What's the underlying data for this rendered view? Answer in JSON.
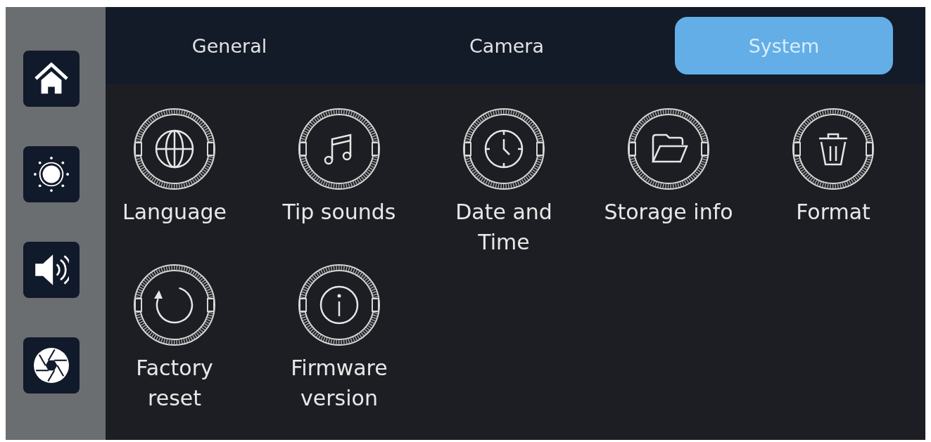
{
  "tabs": [
    {
      "label": "General",
      "selected": false
    },
    {
      "label": "Camera",
      "selected": false
    },
    {
      "label": "System",
      "selected": true
    }
  ],
  "settings": {
    "items": [
      {
        "label": "Language"
      },
      {
        "label": "Tip sounds"
      },
      {
        "label": "Date and Time"
      },
      {
        "label": "Storage info"
      },
      {
        "label": "Format"
      },
      {
        "label": "Factory reset"
      },
      {
        "label": "Firmware version"
      }
    ]
  }
}
